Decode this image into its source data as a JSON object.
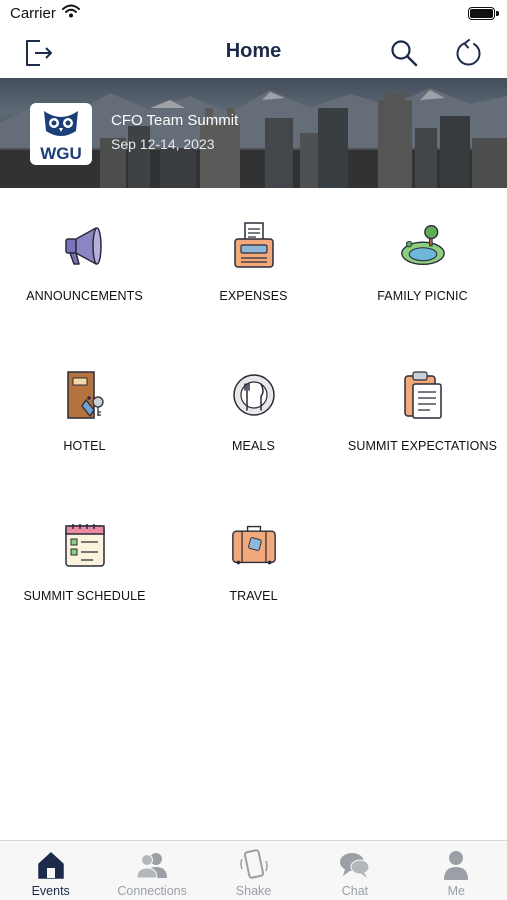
{
  "status_bar": {
    "carrier": "Carrier"
  },
  "nav": {
    "title": "Home"
  },
  "banner": {
    "event_title": "CFO Team Summit",
    "event_date": "Sep 12-14, 2023",
    "logo_text": "WGU"
  },
  "tiles": [
    {
      "label": "ANNOUNCEMENTS",
      "icon": "megaphone-icon"
    },
    {
      "label": "EXPENSES",
      "icon": "receipt-machine-icon"
    },
    {
      "label": "FAMILY PICNIC",
      "icon": "park-pond-icon"
    },
    {
      "label": "HOTEL",
      "icon": "hotel-door-key-icon"
    },
    {
      "label": "MEALS",
      "icon": "dinner-plate-icon"
    },
    {
      "label": "SUMMIT EXPECTATIONS",
      "icon": "clipboard-icon"
    },
    {
      "label": "SUMMIT SCHEDULE",
      "icon": "checklist-calendar-icon"
    },
    {
      "label": "TRAVEL",
      "icon": "suitcase-icon"
    }
  ],
  "tab_bar": {
    "active": "Events",
    "tabs": [
      {
        "label": "Events",
        "icon": "calendar-house-icon"
      },
      {
        "label": "Connections",
        "icon": "people-icon"
      },
      {
        "label": "Shake",
        "icon": "phone-shake-icon"
      },
      {
        "label": "Chat",
        "icon": "chat-bubbles-icon"
      },
      {
        "label": "Me",
        "icon": "person-icon"
      }
    ]
  },
  "colors": {
    "primary_navy": "#1c2b4a",
    "tab_inactive": "#9aa0a6",
    "icon_orange": "#f2a97b",
    "icon_purple": "#8b86c4"
  }
}
